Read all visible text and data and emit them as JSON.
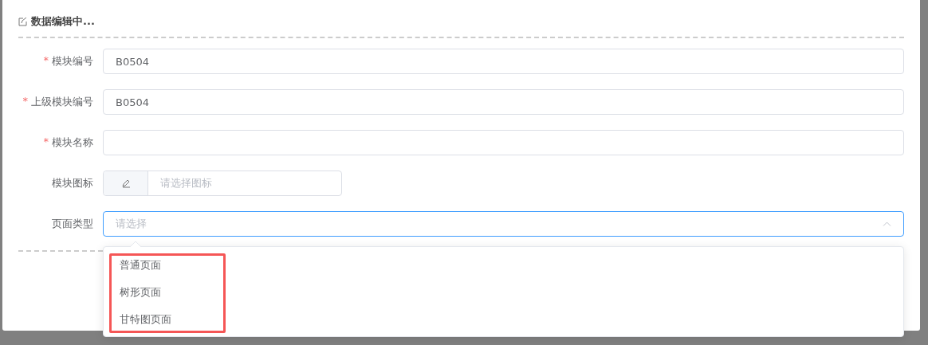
{
  "dialog": {
    "title": "数据编辑中..."
  },
  "fields": [
    {
      "kind": "text",
      "label": "模块编号",
      "required_mark": "*",
      "value": "B0504"
    },
    {
      "kind": "text",
      "label": "上级模块编号",
      "required_mark": "*",
      "value": "B0504"
    },
    {
      "kind": "text",
      "label": "模块名称",
      "required_mark": "*"
    },
    {
      "kind": "icon",
      "label": "模块图标",
      "placeholder": "请选择图标"
    },
    {
      "kind": "select",
      "label": "页面类型",
      "placeholder": "请选择",
      "expanded": true
    }
  ],
  "dropdown": {
    "highlighted": true,
    "options": [
      {
        "label": "普通页面",
        "selected": false
      },
      {
        "label": "树形页面",
        "selected": false
      },
      {
        "label": "甘特图页面",
        "selected": false
      }
    ]
  }
}
